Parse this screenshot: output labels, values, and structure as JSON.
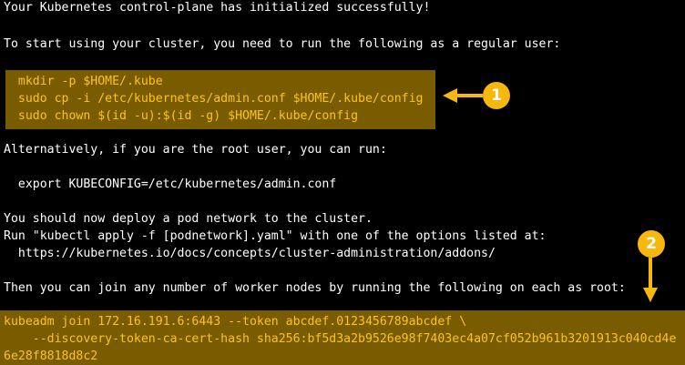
{
  "terminal": {
    "lines": [
      "Your Kubernetes control-plane has initialized successfully!",
      "To start using your cluster, you need to run the following as a regular user:",
      "  mkdir -p $HOME/.kube",
      "  sudo cp -i /etc/kubernetes/admin.conf $HOME/.kube/config",
      "  sudo chown $(id -u):$(id -g) $HOME/.kube/config",
      "Alternatively, if you are the root user, you can run:",
      "  export KUBECONFIG=/etc/kubernetes/admin.conf",
      "You should now deploy a pod network to the cluster.",
      "Run \"kubectl apply -f [podnetwork].yaml\" with one of the options listed at:",
      "  https://kubernetes.io/docs/concepts/cluster-administration/addons/",
      "Then you can join any number of worker nodes by running the following on each as root:",
      "kubeadm join 172.16.191.6:6443 --token abcdef.0123456789abcdef \\",
      "    --discovery-token-ca-cert-hash sha256:bf5d3a2b9526e98f7403ec4a07cf052b961b3201913c040cd4e",
      "6e28f8818d8c2"
    ]
  },
  "callouts": {
    "first": "1",
    "second": "2"
  },
  "colors": {
    "background": "#000000",
    "text": "#ffffff",
    "highlight_box": "#7a5c00",
    "highlight_text": "#ffc21a",
    "callout": "#f6b80c"
  }
}
